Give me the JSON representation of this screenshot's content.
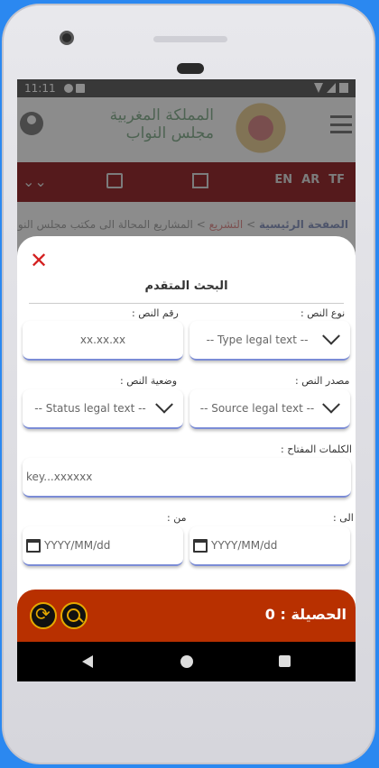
{
  "status_bar": {
    "time": "11:11"
  },
  "header": {
    "brand_line1": "المملكة المغربية",
    "brand_line2": "مجلس النواب"
  },
  "toolbar": {
    "langs": [
      "EN",
      "AR",
      "TF"
    ]
  },
  "breadcrumb": {
    "home": "الصفحة الرئيسية",
    "section": "التشريع",
    "current": "المشاريع المحالة الى مكتب مجلس النواب"
  },
  "sheet": {
    "title": "البحث المتقدم",
    "text_number_label": "رقم النص :",
    "text_number_placeholder": "xx.xx.xx",
    "text_type_label": "نوع النص :",
    "text_type_value": "-- Type legal text --",
    "status_label": "وضعية النص :",
    "status_value": "-- Status legal text --",
    "source_label": "مصدر النص :",
    "source_value": "-- Source legal text --",
    "keywords_label": "الكلمات المفتاح :",
    "keywords_placeholder": "key...xxxxxx",
    "from_label": "من :",
    "from_placeholder": "YYYY/MM/dd",
    "to_label": "الى :",
    "to_placeholder": "YYYY/MM/dd"
  },
  "results": {
    "label": "الحصيلة : 0"
  }
}
